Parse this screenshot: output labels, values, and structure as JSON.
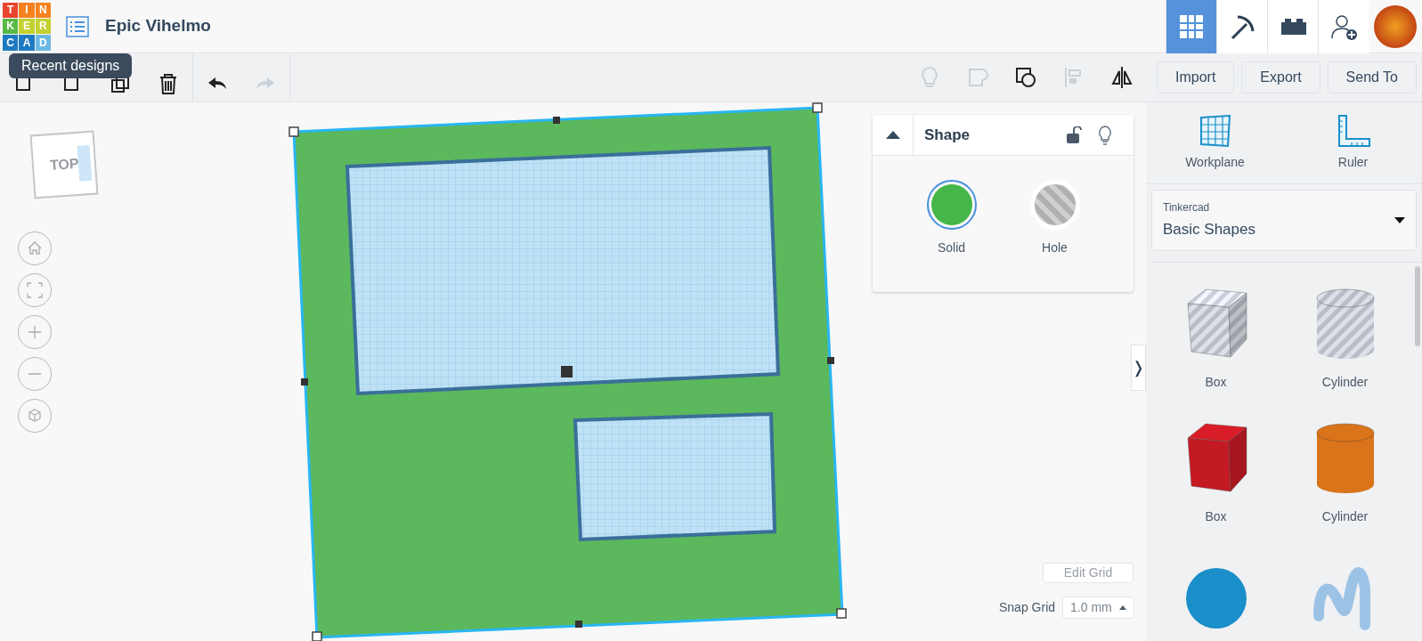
{
  "logo": {
    "letters": [
      "T",
      "I",
      "N",
      "K",
      "E",
      "R",
      "C",
      "A",
      "D"
    ]
  },
  "title": "Epic Vihelmo",
  "tooltip": "Recent designs",
  "nav": [
    {
      "kind": "grid",
      "selected": true
    },
    {
      "kind": "pickaxe",
      "selected": false
    },
    {
      "kind": "brick",
      "selected": false
    },
    {
      "kind": "add-user",
      "selected": false
    }
  ],
  "toolbar_left": [
    {
      "kind": "copy"
    },
    {
      "kind": "paste"
    },
    {
      "kind": "duplicate"
    },
    {
      "kind": "delete",
      "disabled": false
    },
    {
      "kind": "undo",
      "disabled": false
    },
    {
      "kind": "redo",
      "disabled": true
    }
  ],
  "toolbar_right": [
    {
      "kind": "bulb",
      "disabled": true
    },
    {
      "kind": "group",
      "disabled": true
    },
    {
      "kind": "ungroup",
      "disabled": false
    },
    {
      "kind": "align",
      "disabled": true
    },
    {
      "kind": "mirror",
      "disabled": false
    }
  ],
  "actions": [
    "Import",
    "Export",
    "Send To"
  ],
  "view_cube": {
    "label": "TOP"
  },
  "view_controls": [
    {
      "kind": "home"
    },
    {
      "kind": "fit"
    },
    {
      "kind": "zoom-in"
    },
    {
      "kind": "zoom-out"
    },
    {
      "kind": "perspective"
    }
  ],
  "inspector": {
    "title": "Shape",
    "options": [
      {
        "label": "Solid",
        "selected": true
      },
      {
        "label": "Hole",
        "selected": false
      }
    ]
  },
  "edit_grid": "Edit Grid",
  "snap_grid": {
    "label": "Snap Grid",
    "value": "1.0 mm"
  },
  "panel_toggle": "❭",
  "tools": [
    "Workplane",
    "Ruler"
  ],
  "library": {
    "source": "Tinkercad",
    "name": "Basic Shapes"
  },
  "shapes": [
    {
      "kind": "box",
      "color": "#b8bdc7",
      "hole": true,
      "label": "Box"
    },
    {
      "kind": "cylinder",
      "color": "#b8bdc7",
      "hole": true,
      "label": "Cylinder"
    },
    {
      "kind": "box",
      "color": "#c41a24",
      "hole": false,
      "label": "Box"
    },
    {
      "kind": "cylinder",
      "color": "#d9741a",
      "hole": false,
      "label": "Cylinder"
    },
    {
      "kind": "sphere",
      "color": "#1a8fc9",
      "hole": false
    },
    {
      "kind": "scribble",
      "color": "#9cc3e6",
      "hole": false
    }
  ]
}
